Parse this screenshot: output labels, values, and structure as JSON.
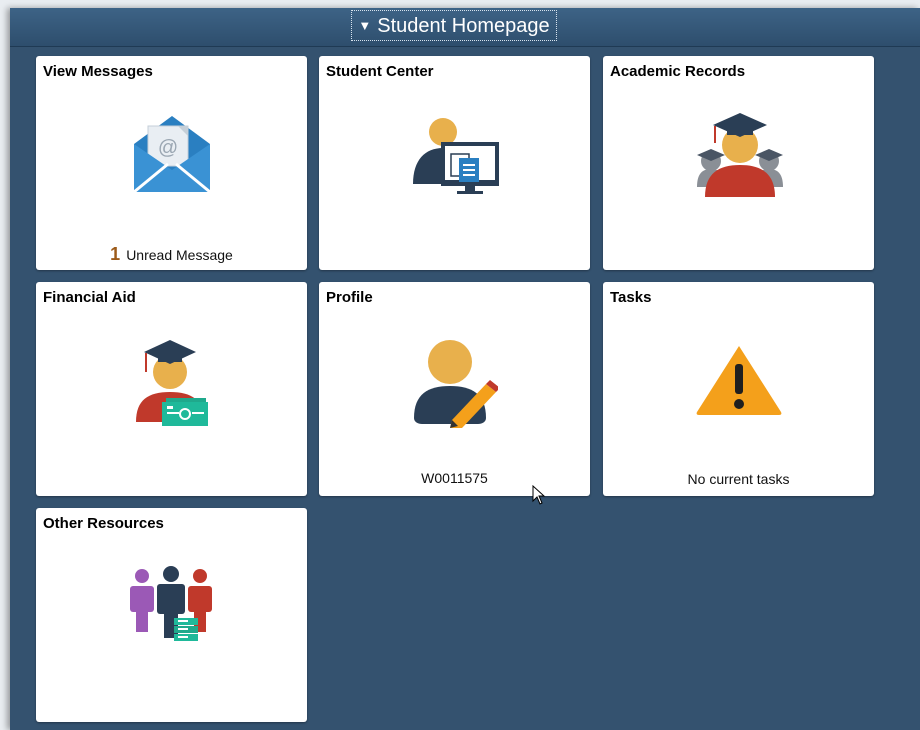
{
  "header": {
    "title": "Student Homepage",
    "caret_icon": "triangle-down-icon"
  },
  "tiles": {
    "view_messages": {
      "title": "View Messages",
      "icon": "envelope-icon",
      "count": "1",
      "count_label": "Unread Message"
    },
    "student_center": {
      "title": "Student Center",
      "icon": "student-computer-icon"
    },
    "academic_records": {
      "title": "Academic Records",
      "icon": "graduates-icon"
    },
    "financial_aid": {
      "title": "Financial Aid",
      "icon": "graduate-money-icon"
    },
    "profile": {
      "title": "Profile",
      "icon": "person-pencil-icon",
      "footer": "W0011575"
    },
    "tasks": {
      "title": "Tasks",
      "icon": "warning-icon",
      "footer": "No current tasks"
    },
    "other_resources": {
      "title": "Other Resources",
      "icon": "people-group-icon"
    }
  },
  "colors": {
    "background": "#34526f",
    "header": "#2e4e6d",
    "tile": "#ffffff",
    "count": "#9c5a19",
    "warning": "#f4a01b",
    "skin": "#e8b04c",
    "navy": "#2a3e55"
  }
}
